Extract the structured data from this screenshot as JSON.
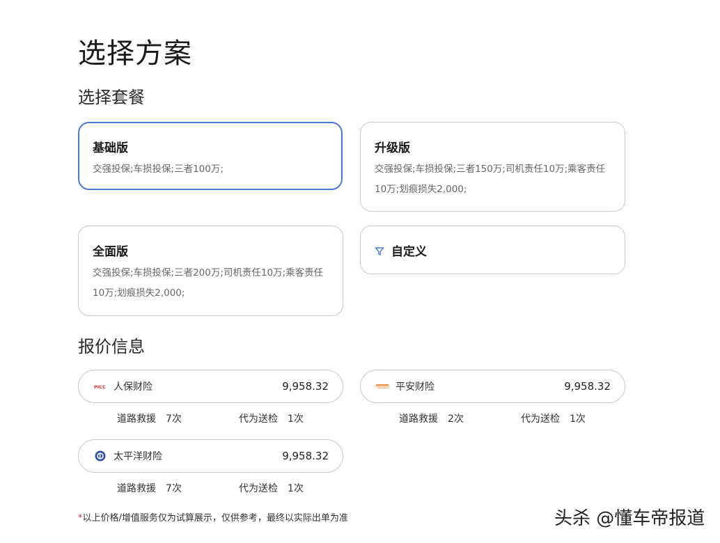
{
  "page": {
    "title": "选择方案",
    "plan_section_title": "选择套餐",
    "quote_section_title": "报价信息"
  },
  "plans": [
    {
      "name": "基础版",
      "desc": "交强投保;车损投保;三者100万;",
      "selected": true
    },
    {
      "name": "升级版",
      "desc": "交强投保;车损投保;三者150万;司机责任10万;乘客责任10万;划痕损失2,000;",
      "selected": false
    },
    {
      "name": "全面版",
      "desc": "交强投保;车损投保;三者200万;司机责任10万;乘客责任10万;划痕损失2,000;",
      "selected": false
    },
    {
      "name": "自定义",
      "icon": "filter-icon",
      "selected": false
    }
  ],
  "quotes": [
    {
      "insurer": "人保财险",
      "logo": "picc-logo",
      "price": "9,958.32",
      "services": [
        {
          "label": "道路救援",
          "value": "7次"
        },
        {
          "label": "代为送检",
          "value": "1次"
        }
      ]
    },
    {
      "insurer": "平安财险",
      "logo": "pingan-logo",
      "price": "9,958.32",
      "services": [
        {
          "label": "道路救援",
          "value": "2次"
        },
        {
          "label": "代为送检",
          "value": "1次"
        }
      ]
    },
    {
      "insurer": "太平洋财险",
      "logo": "cpic-logo",
      "price": "9,958.32",
      "services": [
        {
          "label": "道路救援",
          "value": "7次"
        },
        {
          "label": "代为送检",
          "value": "1次"
        }
      ]
    }
  ],
  "disclaimer": {
    "star": "*",
    "text": "以上价格/增值服务仅为试算展示，仅供参考，最终以实际出单为准"
  },
  "watermark": "头杀 @懂车帝报道",
  "colors": {
    "accent": "#4a76d9",
    "picc_red": "#e0322d",
    "pingan_orange": "#f08a3c",
    "cpic_blue": "#2c4fa8"
  }
}
